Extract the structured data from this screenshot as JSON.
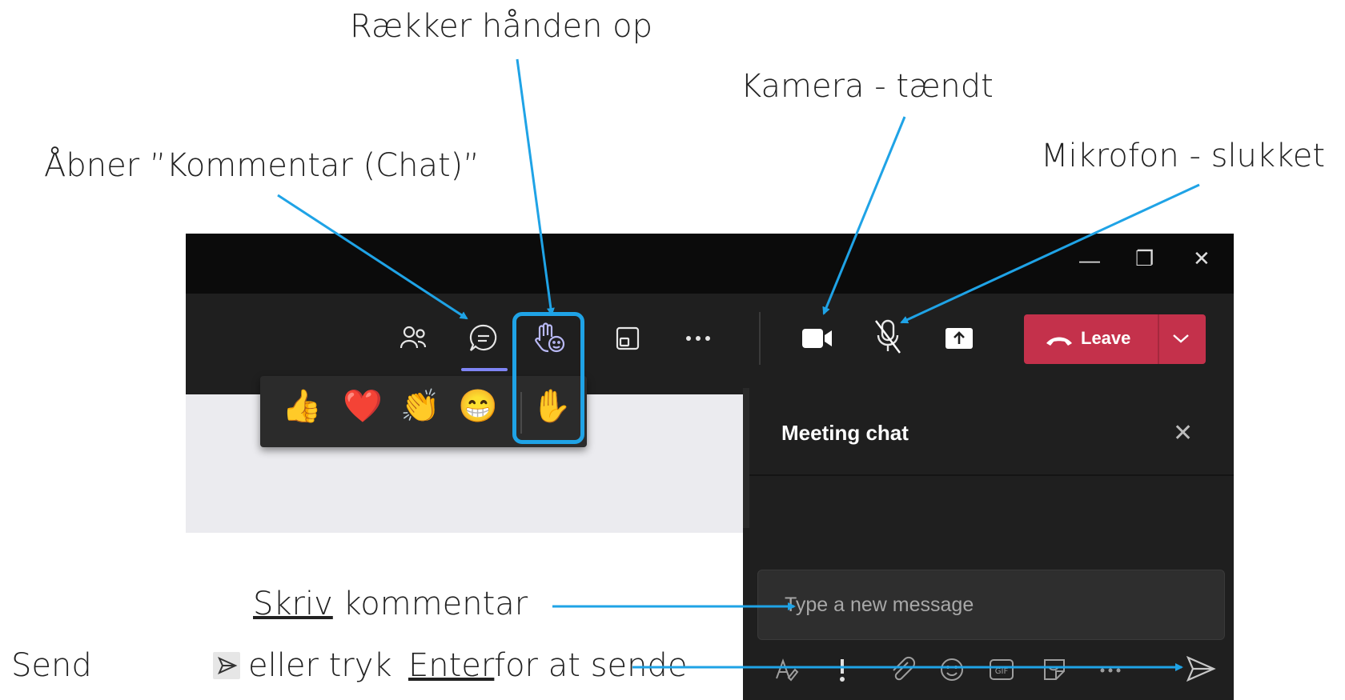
{
  "annotations": {
    "raise_hand": "Rækker hånden op",
    "camera": "Kamera - tændt",
    "open_chat": "Åbner ”Kommentar (Chat)”",
    "mic": "Mikrofon - slukket",
    "write_underlined": "Skriv",
    "write_rest": " kommentar",
    "send_prefix": "Send",
    "send_mid": "eller tryk",
    "send_enter": "Enter",
    "send_suffix": "for at sende"
  },
  "window_controls": {
    "minimize": "—",
    "restore": "❐",
    "close": "✕"
  },
  "toolbar": {
    "icons": [
      "people-icon",
      "chat-icon",
      "raise-hand-icon",
      "share-tray-icon",
      "more-icon",
      "camera-icon",
      "mic-off-icon",
      "share-screen-icon"
    ],
    "leave_label": "Leave"
  },
  "reactions": [
    "👍",
    "❤️",
    "👏",
    "😁",
    "✋"
  ],
  "chat": {
    "title": "Meeting chat",
    "close": "✕",
    "placeholder": "Type a new message",
    "tools": [
      "format-icon",
      "priority-icon",
      "attach-icon",
      "emoji-icon",
      "gif-icon",
      "sticker-icon",
      "more-icon",
      "send-icon"
    ]
  },
  "colors": {
    "accent": "#1fa3e6",
    "leave": "#c4314b",
    "title_bar": "#0b0b0b",
    "toolbar": "#1f1f1f"
  }
}
